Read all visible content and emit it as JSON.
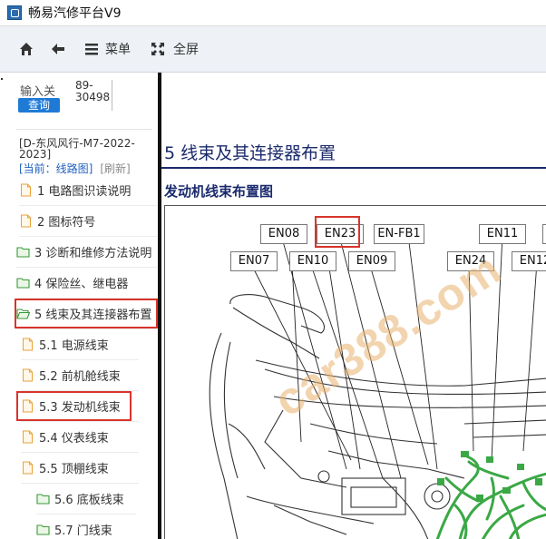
{
  "window": {
    "title": "畅易汽修平台V9"
  },
  "toolbar": {
    "menu_label": "菜单",
    "fullscreen_label": "全屏"
  },
  "sidebar": {
    "search_label": "输入关",
    "search_button": "查询",
    "search_value": "89-30498",
    "vehicle": "[D-东风风行-M7-2022-2023]",
    "current_label": "[当前：线路图]",
    "refresh_label": "[刷新]",
    "tree": [
      {
        "label": "1 电路图识读说明",
        "type": "file"
      },
      {
        "label": "2 图标符号",
        "type": "file"
      },
      {
        "label": "3 诊断和维修方法说明",
        "type": "folder"
      },
      {
        "label": "4 保险丝、继电器",
        "type": "folder"
      },
      {
        "label": "5 线束及其连接器布置",
        "type": "folder-open",
        "highlighted": true
      },
      {
        "label": "5.1 电源线束",
        "type": "file"
      },
      {
        "label": "5.2 前机舱线束",
        "type": "file"
      },
      {
        "label": "5.3 发动机线束",
        "type": "file",
        "highlighted": true
      },
      {
        "label": "5.4 仪表线束",
        "type": "file"
      },
      {
        "label": "5.5 顶棚线束",
        "type": "file"
      },
      {
        "label": "5.6 底板线束",
        "type": "folder"
      },
      {
        "label": "5.7 门线束",
        "type": "folder"
      }
    ]
  },
  "content": {
    "section_title": "5 线束及其连接器布置",
    "subsection_title": "发动机线束布置图",
    "connectors": [
      "EN08",
      "EN23",
      "EN-FB1",
      "EN11",
      "EN07",
      "EN10",
      "EN09",
      "EN24",
      "EN12"
    ],
    "highlighted_connector": "EN23",
    "watermark": "car388.com"
  },
  "colors": {
    "accent": "#1f7ad6",
    "heading": "#1a2a6c",
    "highlight": "#d9342b",
    "harness": "#3aa845"
  }
}
